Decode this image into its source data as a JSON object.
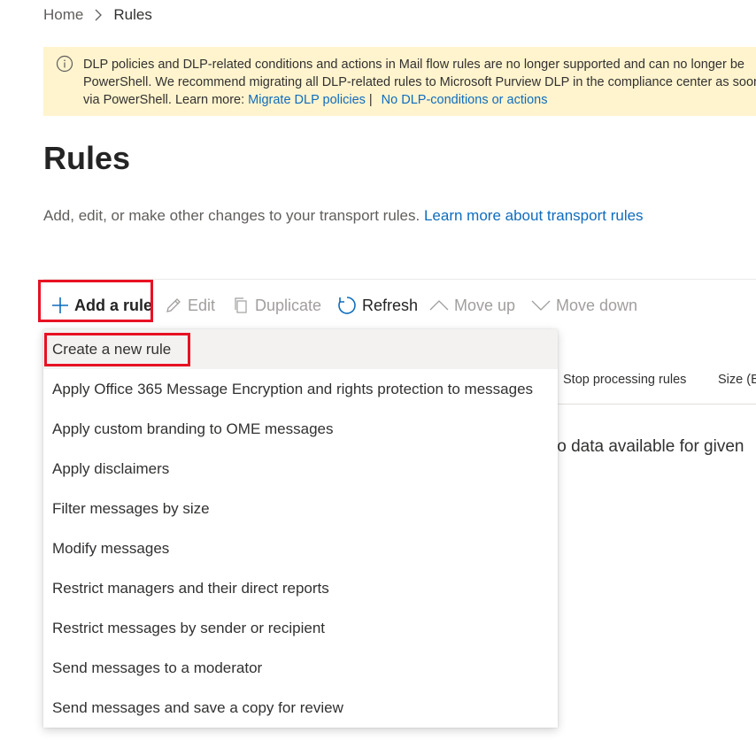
{
  "breadcrumb": {
    "home": "Home",
    "current": "Rules"
  },
  "banner": {
    "line1": "DLP policies and DLP-related conditions and actions in Mail flow rules are no longer supported and can no longer be",
    "line2": "PowerShell. We recommend migrating all DLP-related rules to Microsoft Purview DLP in the compliance center as soon",
    "line3_prefix": "via PowerShell. Learn more: ",
    "link1": "Migrate DLP policies",
    "separator": "|",
    "link2": "No DLP-conditions or actions"
  },
  "page": {
    "title": "Rules",
    "description": "Add, edit, or make other changes to your transport rules.",
    "learn_more": "Learn more about transport rules"
  },
  "toolbar": {
    "add": "Add a rule",
    "edit": "Edit",
    "duplicate": "Duplicate",
    "refresh": "Refresh",
    "move_up": "Move up",
    "move_down": "Move down"
  },
  "table": {
    "columns": [
      "Stop processing rules",
      "Size (B"
    ],
    "empty_message": "lo data available for given"
  },
  "menu": {
    "items": [
      "Create a new rule",
      "Apply Office 365 Message Encryption and rights protection to messages",
      "Apply custom branding to OME messages",
      "Apply disclaimers",
      "Filter messages by size",
      "Modify messages",
      "Restrict managers and their direct reports",
      "Restrict messages by sender or recipient",
      "Send messages to a moderator",
      "Send messages and save a copy for review"
    ]
  },
  "colors": {
    "accent_link": "#0f6cbd",
    "banner_bg": "#fff4ce",
    "highlight": "#e81123"
  }
}
